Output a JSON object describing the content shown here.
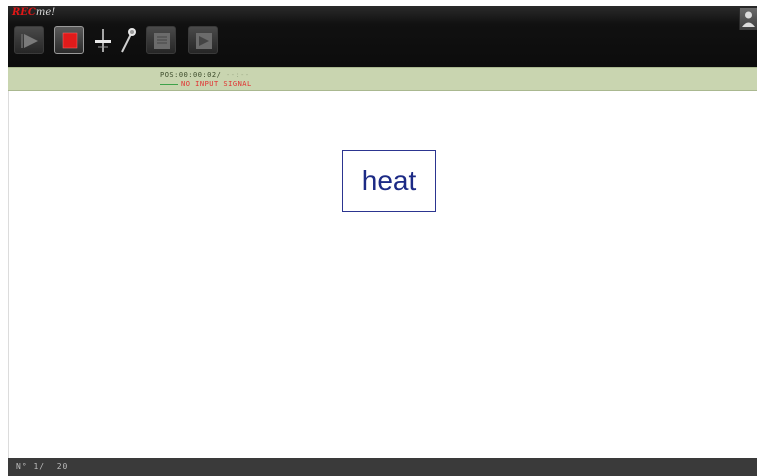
{
  "app": {
    "logo_prefix": "REC",
    "logo_suffix": "me!"
  },
  "toolbar": {
    "buttons": [
      {
        "name": "play",
        "icon": "play-icon",
        "enabled": false
      },
      {
        "name": "stop",
        "icon": "stop-icon",
        "enabled": true,
        "active_color": "#e01b1b"
      },
      {
        "name": "level",
        "icon": "level-slider-icon",
        "enabled": true
      },
      {
        "name": "microphone",
        "icon": "microphone-icon",
        "enabled": true
      },
      {
        "name": "previous-page",
        "icon": "page-back-icon",
        "enabled": false
      },
      {
        "name": "next-page",
        "icon": "page-forward-icon",
        "enabled": false
      }
    ],
    "user_icon": "user-icon"
  },
  "status": {
    "pos_label": "POS:",
    "pos_time": "00:00:02/",
    "pos_total_dim": "--:--",
    "signal_text": "NO INPUT SIGNAL"
  },
  "stage": {
    "word": "heat"
  },
  "footer": {
    "counter": "N° 1/  20"
  },
  "colors": {
    "toolbar_bg": "#111111",
    "status_bg": "#c9d5b0",
    "signal_red": "#e23030",
    "word_blue": "#1c2a85",
    "footer_bg": "#3a3a3a"
  }
}
